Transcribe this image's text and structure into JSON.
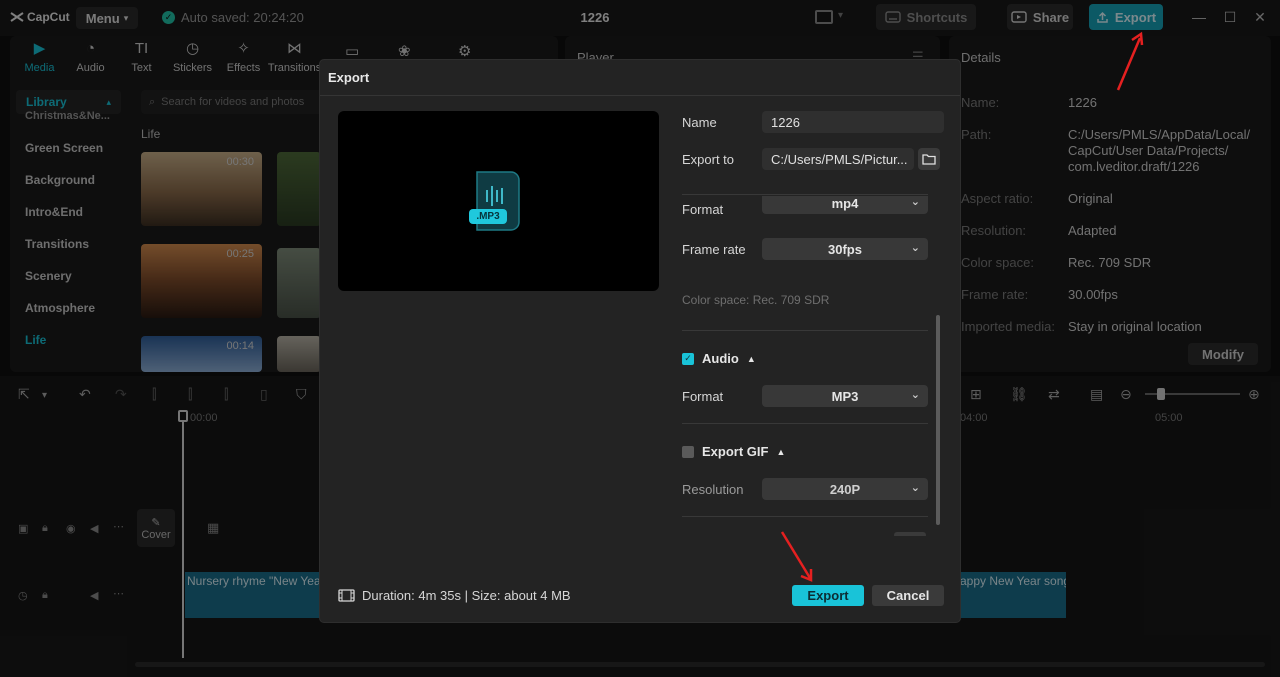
{
  "app": {
    "logo": "CapCut",
    "menu_label": "Menu",
    "autosave": "Auto saved: 20:24:20",
    "project_title": "1226",
    "shortcuts_label": "Shortcuts",
    "share_label": "Share",
    "export_label": "Export",
    "accent_color": "#19c3d8"
  },
  "media_tabs": [
    {
      "label": "Media",
      "icon": "media-icon"
    },
    {
      "label": "Audio",
      "icon": "audio-icon"
    },
    {
      "label": "Text",
      "icon": "text-icon"
    },
    {
      "label": "Stickers",
      "icon": "stickers-icon"
    },
    {
      "label": "Effects",
      "icon": "effects-icon"
    },
    {
      "label": "Transitions",
      "icon": "transitions-icon"
    }
  ],
  "library": {
    "head": "Library",
    "partial_item": "Christmas&Ne...",
    "items": [
      "Green Screen",
      "Background",
      "Intro&End",
      "Transitions",
      "Scenery",
      "Atmosphere",
      "Life"
    ],
    "search_placeholder": "Search for videos and photos",
    "section": "Life",
    "thumbs": [
      {
        "duration": "00:30"
      },
      {
        "duration": "00:25"
      },
      {
        "duration": "00:14"
      }
    ]
  },
  "player": {
    "title": "Player"
  },
  "details": {
    "title": "Details",
    "rows": [
      {
        "label": "Name:",
        "value": "1226"
      },
      {
        "label": "Path:",
        "value": "C:/Users/PMLS/AppData/Local/\nCapCut/User Data/Projects/\ncom.lveditor.draft/1226"
      },
      {
        "label": "Aspect ratio:",
        "value": "Original"
      },
      {
        "label": "Resolution:",
        "value": "Adapted"
      },
      {
        "label": "Color space:",
        "value": "Rec. 709 SDR"
      },
      {
        "label": "Frame rate:",
        "value": "30.00fps"
      },
      {
        "label": "Imported media:",
        "value": "Stay in original location"
      }
    ],
    "modify_label": "Modify"
  },
  "timeline": {
    "ruler": [
      "00:00",
      "04:00",
      "05:00"
    ],
    "cover_label": "Cover",
    "audio_clip_left": "Nursery rhyme \"New Year",
    "audio_clip_right": "appy New Year song"
  },
  "export_dialog": {
    "title": "Export",
    "badge": ".MP3",
    "name_label": "Name",
    "name_value": "1226",
    "export_to_label": "Export to",
    "export_to_value": "C:/Users/PMLS/Pictur...",
    "format_label_partial": "Format",
    "format_value_partial": "mp4",
    "frame_rate_label": "Frame rate",
    "frame_rate_value": "30fps",
    "color_space": "Color space: Rec. 709 SDR",
    "audio_section": "Audio",
    "audio_format_label": "Format",
    "audio_format_value": "MP3",
    "gif_section": "Export GIF",
    "gif_resolution_label": "Resolution",
    "gif_resolution_value": "240P",
    "footer_info": "Duration: 4m 35s | Size: about 4 MB",
    "export_button": "Export",
    "cancel_button": "Cancel"
  }
}
